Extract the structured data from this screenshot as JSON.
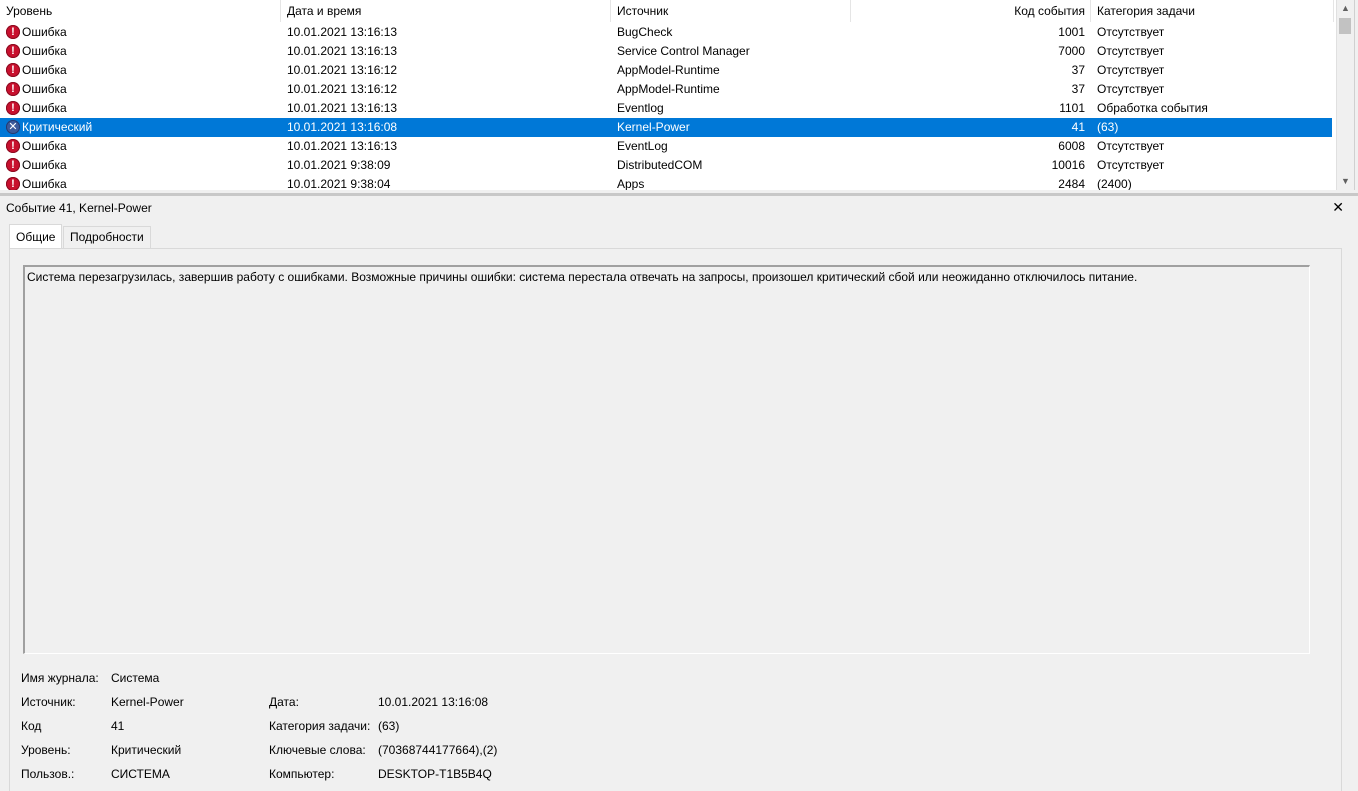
{
  "columns": {
    "level": "Уровень",
    "date": "Дата и время",
    "source": "Источник",
    "code": "Код события",
    "category": "Категория задачи"
  },
  "events": [
    {
      "level": "Ошибка",
      "icon": "error-icon",
      "date": "10.01.2021 13:16:13",
      "source": "BugCheck",
      "code": "1001",
      "category": "Отсутствует"
    },
    {
      "level": "Ошибка",
      "icon": "error-icon",
      "date": "10.01.2021 13:16:13",
      "source": "Service Control Manager",
      "code": "7000",
      "category": "Отсутствует"
    },
    {
      "level": "Ошибка",
      "icon": "error-icon",
      "date": "10.01.2021 13:16:12",
      "source": "AppModel-Runtime",
      "code": "37",
      "category": "Отсутствует"
    },
    {
      "level": "Ошибка",
      "icon": "error-icon",
      "date": "10.01.2021 13:16:12",
      "source": "AppModel-Runtime",
      "code": "37",
      "category": "Отсутствует"
    },
    {
      "level": "Ошибка",
      "icon": "error-icon",
      "date": "10.01.2021 13:16:13",
      "source": "Eventlog",
      "code": "1101",
      "category": "Обработка события"
    },
    {
      "level": "Критический",
      "icon": "critical-icon",
      "date": "10.01.2021 13:16:08",
      "source": "Kernel-Power",
      "code": "41",
      "category": "(63)",
      "selected": true
    },
    {
      "level": "Ошибка",
      "icon": "error-icon",
      "date": "10.01.2021 13:16:13",
      "source": "EventLog",
      "code": "6008",
      "category": "Отсутствует"
    },
    {
      "level": "Ошибка",
      "icon": "error-icon",
      "date": "10.01.2021 9:38:09",
      "source": "DistributedCOM",
      "code": "10016",
      "category": "Отсутствует"
    },
    {
      "level": "Ошибка",
      "icon": "error-icon",
      "date": "10.01.2021 9:38:04",
      "source": "Apps",
      "code": "2484",
      "category": "(2400)"
    }
  ],
  "detail": {
    "title": "Событие 41, Kernel-Power",
    "close": "✕",
    "tabs": [
      "Общие",
      "Подробности"
    ],
    "description": "Система перезагрузилась, завершив работу с ошибками. Возможные причины ошибки: система перестала отвечать на запросы, произошел критический сбой или неожиданно отключилось питание.",
    "props": {
      "log_label": "Имя журнала:",
      "log_value": "Система",
      "source_label": "Источник:",
      "source_value": "Kernel-Power",
      "date_label": "Дата:",
      "date_value": "10.01.2021 13:16:08",
      "code_label": "Код",
      "code_value": "41",
      "category_label": "Категория задачи:",
      "category_value": "(63)",
      "level_label": "Уровень:",
      "level_value": "Критический",
      "keywords_label": "Ключевые слова:",
      "keywords_value": "(70368744177664),(2)",
      "user_label": "Пользов.:",
      "user_value": "СИСТЕМА",
      "computer_label": "Компьютер:",
      "computer_value": "DESKTOP-T1B5B4Q"
    }
  },
  "colors": {
    "selection": "#0078d7",
    "error": "#c8102e",
    "critical": "#3c5a9a"
  }
}
